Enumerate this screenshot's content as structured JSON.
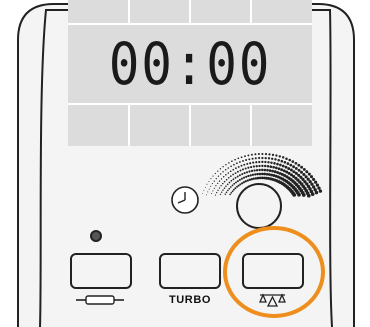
{
  "display": {
    "time": "00:00"
  },
  "buttons": {
    "turbo_label": "TURBO"
  },
  "colors": {
    "panel": "#f4f4f4",
    "display_bg": "#dcdcdc",
    "outline": "#222222",
    "highlight": "#ee8e1c"
  },
  "icons": {
    "clock": "clock-icon",
    "rolling_pin": "rolling-pin-icon",
    "scale": "scale-icon",
    "speed_dial": "speed-dial-icon",
    "led": "indicator-led"
  }
}
